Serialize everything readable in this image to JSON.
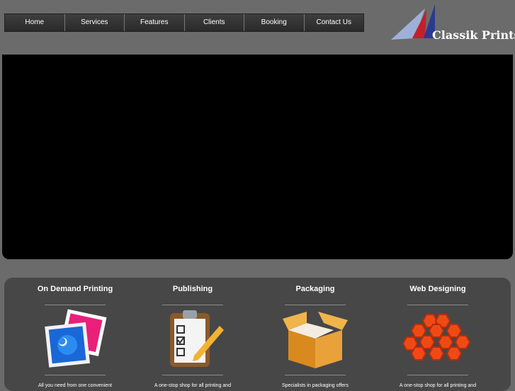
{
  "nav": {
    "items": [
      {
        "label": "Home"
      },
      {
        "label": "Services"
      },
      {
        "label": "Features"
      },
      {
        "label": "Clients"
      },
      {
        "label": "Booking"
      },
      {
        "label": "Contact Us"
      }
    ]
  },
  "brand": {
    "name": "Classik Prints"
  },
  "services": [
    {
      "title": "On Demand Printing",
      "icon": "photo-prints-icon",
      "desc": "All you need from one convenient"
    },
    {
      "title": "Publishing",
      "icon": "clipboard-checklist-icon",
      "desc": "A one-stop shop for all printing and"
    },
    {
      "title": "Packaging",
      "icon": "cardboard-box-icon",
      "desc": "Specialists in packaging offers"
    },
    {
      "title": "Web Designing",
      "icon": "hexagon-cluster-icon",
      "desc": "A one-stop shop for all printing and"
    }
  ]
}
